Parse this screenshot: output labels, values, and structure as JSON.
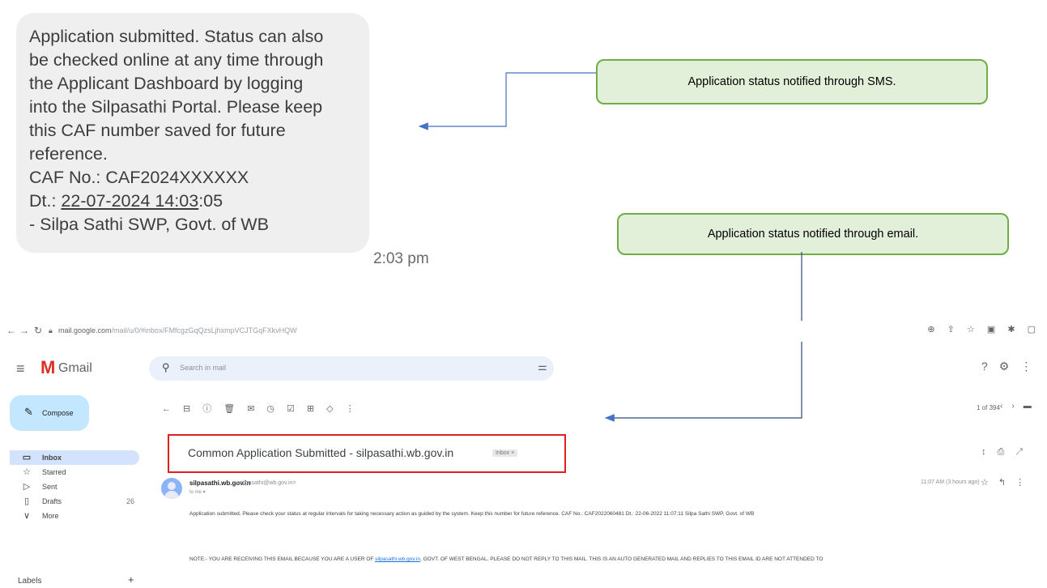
{
  "sms": {
    "line1": "Application submitted. Status can also",
    "line2": "be checked online at any time through",
    "line3": "the Applicant Dashboard by logging",
    "line4": "into the Silpasathi Portal. Please keep",
    "line5": "this CAF number saved for future",
    "line6": "reference.",
    "caf": "CAF No.: CAF2024XXXXXX",
    "dt_prefix": "Dt.: ",
    "dt_underlined": "22-07-2024 14:03",
    "dt_suffix": ":05",
    "signature": "- Silpa Sathi SWP, Govt. of WB",
    "time": "2:03 pm"
  },
  "callouts": {
    "sms": "Application status notified through SMS.",
    "email": "Application status notified through email.",
    "fill_color": "#e2efd9",
    "border_color": "#70ad47",
    "arrow_color": "#4472c4"
  },
  "browser": {
    "url_host": "mail.google.com",
    "url_path": "/mail/u/0/#inbox/FMfcgzGqQzsLjhxmpVCJTGqFXkvHQW"
  },
  "gmail": {
    "brand": "Gmail",
    "search_placeholder": "Search in mail",
    "compose": "Compose",
    "sidebar": [
      {
        "label": "Inbox",
        "icon": "inbox-icon",
        "count": ""
      },
      {
        "label": "Starred",
        "icon": "star-icon",
        "count": ""
      },
      {
        "label": "Sent",
        "icon": "send-icon",
        "count": ""
      },
      {
        "label": "Drafts",
        "icon": "draft-icon",
        "count": "26"
      },
      {
        "label": "More",
        "icon": "chevron-down-icon",
        "count": ""
      }
    ],
    "labels_title": "Labels",
    "pager": "1 of 394",
    "subject": "Common Application Submitted - silpasathi.wb.gov.in",
    "subject_label": "Inbox ×",
    "sender_name": "silpasathi.wb.gov.in",
    "sender_email": "<silpasathi@wb.gov.in>",
    "to": "to me ▾",
    "time": "11:07 AM (3 hours ago)",
    "body1": "Application submitted. Please check your status at regular intervals for taking necessary action as guided by the system. Keep this number for future reference. CAF No.: CAF2022060481 Dt.: 22-06-2022 11:07:11 Silpa Sathi SWP, Govt. of WB",
    "body2_before": "NOTE:- YOU ARE RECEIVING THIS EMAIL BECAUSE YOU ARE A USER OF ",
    "body2_link": "silpasathi.wb.gov.in",
    "body2_after": ", GOVT. OF WEST BENGAL. PLEASE DO NOT REPLY TO THIS MAIL. THIS IS AN AUTO GENERATED MAIL AND REPLIES TO THIS EMAIL ID ARE NOT ATTENDED TO"
  }
}
